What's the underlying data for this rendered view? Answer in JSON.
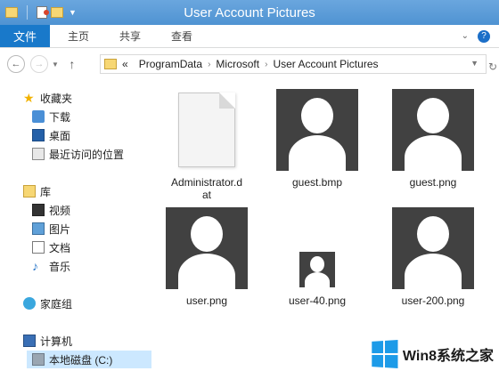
{
  "window": {
    "title": "User Account Pictures"
  },
  "ribbon": {
    "file_tab": "文件",
    "tabs": [
      "主页",
      "共享",
      "查看"
    ]
  },
  "address": {
    "path": [
      "ProgramData",
      "Microsoft",
      "User Account Pictures"
    ],
    "prefix": "«"
  },
  "nav": {
    "favorites": "收藏夹",
    "downloads": "下载",
    "desktop": "桌面",
    "recent": "最近访问的位置",
    "libraries": "库",
    "videos": "视频",
    "pictures": "图片",
    "documents": "文档",
    "music": "音乐",
    "homegroup": "家庭组",
    "computer": "计算机",
    "local_disk": "本地磁盘 (C:)"
  },
  "files": [
    {
      "name": "Administrator.dat",
      "line1": "Administrator.d",
      "line2": "at",
      "type": "document"
    },
    {
      "name": "guest.bmp",
      "type": "user-picture"
    },
    {
      "name": "guest.png",
      "type": "user-picture"
    },
    {
      "name": "user.png",
      "type": "user-picture"
    },
    {
      "name": "user-40.png",
      "type": "user-picture"
    },
    {
      "name": "user-200.png",
      "type": "user-picture"
    }
  ],
  "watermark": {
    "text": "Win8系统之家"
  },
  "colors": {
    "titlebar": "#5b9bd5",
    "file_tab": "#1979ca",
    "thumb_bg": "#414141",
    "accent": "#1d9be8"
  }
}
